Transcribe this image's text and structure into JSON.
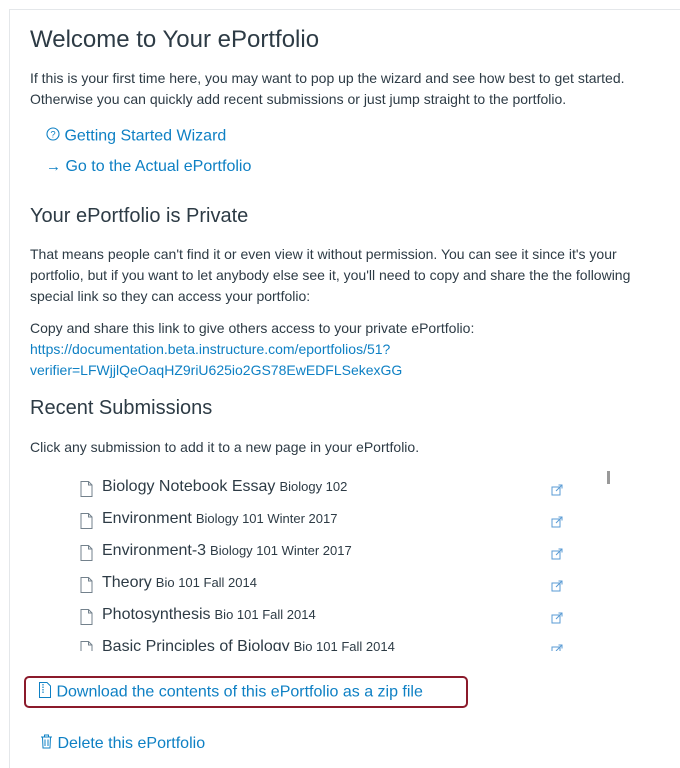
{
  "welcome": {
    "title": "Welcome to Your ePortfolio",
    "intro_line1": "If this is your first time here, you may want to pop up the wizard and see how best to get started.",
    "intro_line2": "Otherwise you can quickly add recent submissions or just jump straight to the portfolio.",
    "wizard_link": "Getting Started Wizard",
    "wizard_icon": "question-circle-icon",
    "portfolio_link": "Go to the Actual ePortfolio",
    "portfolio_arrow": "→"
  },
  "private": {
    "title": "Your ePortfolio is Private",
    "line1": "That means people can't find it or even view it without permission. You can see it since it's your",
    "line2": "portfolio, but if you want to let anybody else see it, you'll need to copy and share the the following",
    "line3": "special link so they can access your portfolio:",
    "share_label": "Copy and share this link to give others access to your private ePortfolio:",
    "share_url_line1": "https://documentation.beta.instructure.com/eportfolios/51?",
    "share_url_line2": "verifier=LFWjjlQeOaqHZ9riU625io2GS78EwEDFLSekexGG"
  },
  "submissions": {
    "title": "Recent Submissions",
    "instruction": "Click any submission to add it to a new page in your ePortfolio.",
    "items": [
      {
        "title": "Biology Notebook Essay",
        "course": "Biology 102"
      },
      {
        "title": "Environment",
        "course": "Biology 101 Winter 2017"
      },
      {
        "title": "Environment-3",
        "course": "Biology 101 Winter 2017"
      },
      {
        "title": "Theory",
        "course": "Bio 101 Fall 2014"
      },
      {
        "title": "Photosynthesis",
        "course": "Bio 101 Fall 2014"
      },
      {
        "title": "Basic Principles of Biology",
        "course": "Bio 101 Fall 2014"
      }
    ]
  },
  "actions": {
    "download_zip": "Download the contents of this ePortfolio as a zip file",
    "delete": "Delete this ePortfolio"
  },
  "colors": {
    "link": "#0e80c4",
    "text": "#2d3b45",
    "highlight_border": "#8b1a2b"
  }
}
